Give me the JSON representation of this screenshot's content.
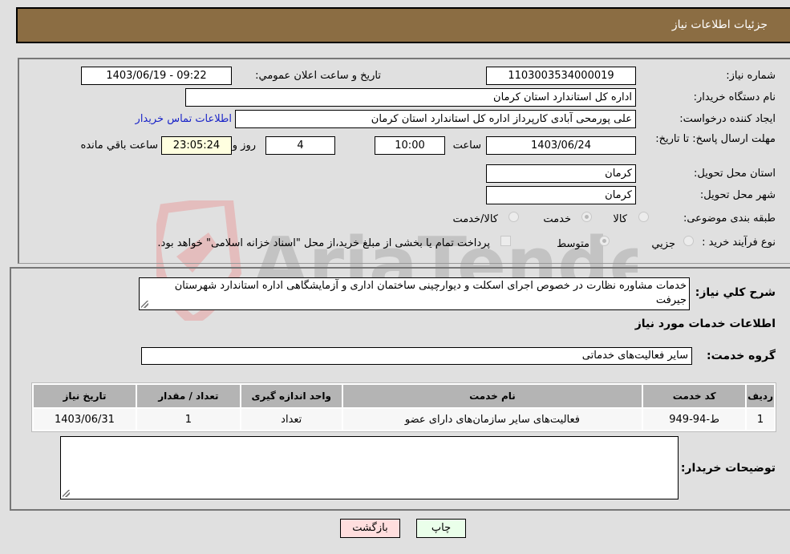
{
  "header": {
    "title": "جزئیات اطلاعات نیاز"
  },
  "form": {
    "need_number": {
      "label": "شماره نیاز:",
      "value": "1103003534000019"
    },
    "announce_datetime": {
      "label": "تاریخ و ساعت اعلان عمومي:",
      "value": "1403/06/19 - 09:22"
    },
    "buyer_org": {
      "label": "نام دستگاه خریدار:",
      "value": "اداره کل استاندارد استان کرمان"
    },
    "requester": {
      "label": "ایجاد کننده درخواست:",
      "value": "علی پورمحی آبادی کارپرداز اداره کل استاندارد استان کرمان"
    },
    "buyer_contact_link": "اطلاعات تماس خریدار",
    "deadline": {
      "label": "مهلت ارسال پاسخ: تا تاریخ:",
      "date": "1403/06/24",
      "time_label": "ساعت",
      "time": "10:00",
      "days": "4",
      "days_label": "روز و",
      "remaining": "23:05:24",
      "remaining_label": "ساعت باقي مانده"
    },
    "delivery_province": {
      "label": "استان محل تحویل:",
      "value": "کرمان"
    },
    "delivery_city": {
      "label": "شهر محل تحویل:",
      "value": "کرمان"
    },
    "category": {
      "label": "طبقه بندی موضوعی:",
      "options": [
        "کالا",
        "خدمت",
        "کالا/خدمت"
      ],
      "selected": "خدمت"
    },
    "purchase_process": {
      "label": "نوع فرآیند خرید :",
      "options": [
        "جزيي",
        "متوسط"
      ],
      "selected": "متوسط",
      "treasury_checkbox_label": "پرداخت تمام یا بخشی از مبلغ خرید،از محل \"اسناد خزانه اسلامی\" خواهد بود.",
      "treasury_checked": false
    }
  },
  "description": {
    "label": "شرح کلي نیاز:",
    "value": "خدمات مشاوره  نظارت در خصوص اجرای اسکلت و دیوارچینی ساختمان اداری و آزمایشگاهی اداره استاندارد شهرستان جیرفت"
  },
  "services_section": {
    "title": "اطلاعات خدمات مورد نیاز",
    "group_label": "گروه خدمت:",
    "group_value": "سایر فعالیت‌های خدماتی",
    "table": {
      "columns": [
        "ردیف",
        "کد خدمت",
        "نام خدمت",
        "واحد اندازه گیری",
        "تعداد / مقدار",
        "تاریخ نیاز"
      ],
      "rows": [
        [
          "1",
          "ط-94-949",
          "فعالیت‌های سایر سازمان‌های دارای عضو",
          "تعداد",
          "1",
          "1403/06/31"
        ]
      ]
    }
  },
  "buyer_notes": {
    "label": "توضیحات خریدار:",
    "value": ""
  },
  "buttons": {
    "print": "چاپ",
    "back": "بازگشت"
  },
  "colors": {
    "header_bg": "#8b6d43",
    "print_bg": "#eaffea",
    "back_bg": "#ffdede",
    "link": "#1a24c8"
  },
  "watermark": "AriaTender.neT"
}
